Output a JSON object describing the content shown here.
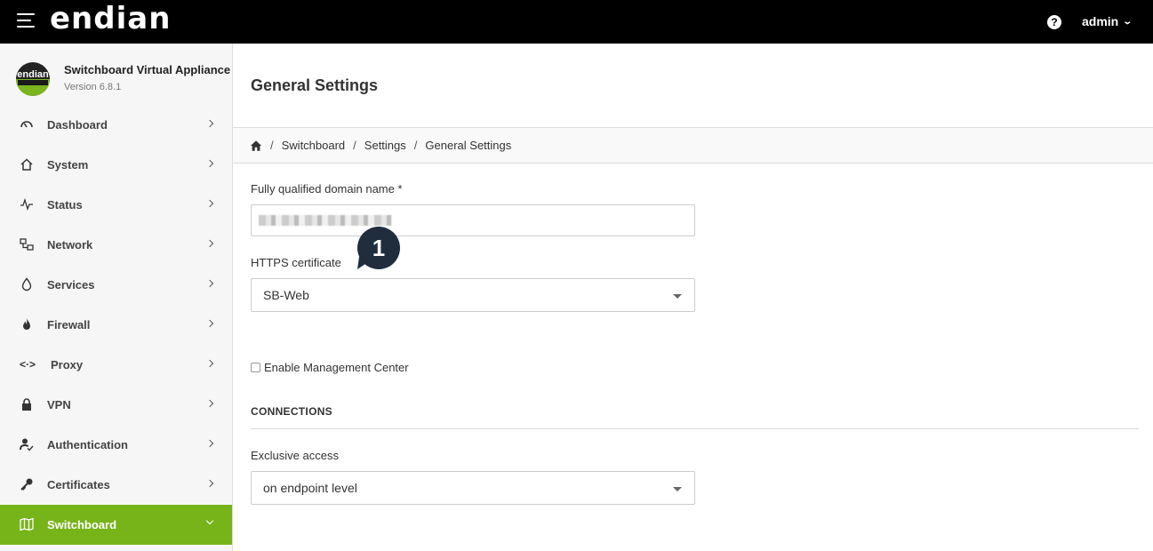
{
  "topbar": {
    "logo": "endian",
    "help_icon": "?",
    "user": "admin"
  },
  "sidebar": {
    "app_name": "Switchboard Virtual Appliance",
    "app_version": "Version 6.8.1",
    "logo_text": "endian",
    "items": [
      {
        "label": "Dashboard",
        "icon": "gauge-icon"
      },
      {
        "label": "System",
        "icon": "home-icon"
      },
      {
        "label": "Status",
        "icon": "pulse-icon"
      },
      {
        "label": "Network",
        "icon": "network-icon"
      },
      {
        "label": "Services",
        "icon": "drop-icon"
      },
      {
        "label": "Firewall",
        "icon": "flame-icon"
      },
      {
        "label": "Proxy",
        "icon": "proxy-icon"
      },
      {
        "label": "VPN",
        "icon": "lock-icon"
      },
      {
        "label": "Authentication",
        "icon": "user-check-icon"
      },
      {
        "label": "Certificates",
        "icon": "key-icon"
      },
      {
        "label": "Switchboard",
        "icon": "map-icon",
        "active": true
      }
    ],
    "active_color": "#77b41a"
  },
  "main": {
    "title": "General Settings",
    "breadcrumb": [
      "Switchboard",
      "Settings",
      "General Settings"
    ],
    "fqdn_label": "Fully qualified domain name *",
    "https_label": "HTTPS certificate",
    "https_value": "SB-Web",
    "marker_number": "1",
    "mgmt_center_label": "Enable Management Center",
    "connections_title": "CONNECTIONS",
    "exclusive_label": "Exclusive access",
    "exclusive_value": "on endpoint level"
  }
}
